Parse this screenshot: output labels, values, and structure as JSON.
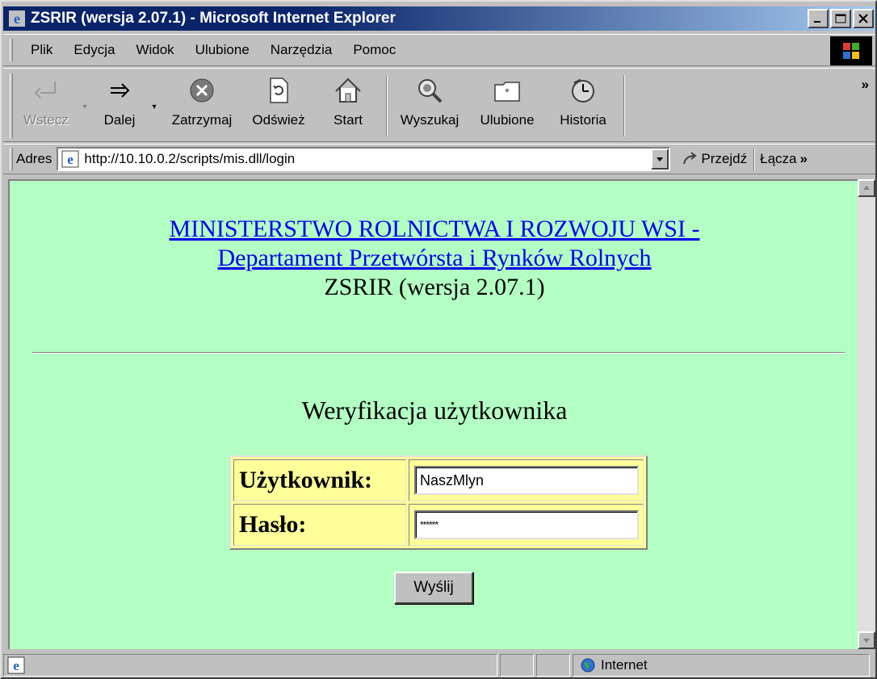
{
  "window": {
    "title": "ZSRIR (wersja 2.07.1) - Microsoft Internet Explorer"
  },
  "menu": {
    "items": [
      "Plik",
      "Edycja",
      "Widok",
      "Ulubione",
      "Narzędzia",
      "Pomoc"
    ]
  },
  "toolbar": {
    "back": "Wstecz",
    "forward": "Dalej",
    "stop": "Zatrzymaj",
    "refresh": "Odśwież",
    "home": "Start",
    "search": "Wyszukaj",
    "favorites": "Ulubione",
    "history": "Historia",
    "more": "»"
  },
  "address": {
    "label": "Adres",
    "url": "http://10.10.0.2/scripts/mis.dll/login",
    "go": "Przejdź",
    "links": "Łącza",
    "links_more": "»"
  },
  "page": {
    "ministry_line1": "MINISTERSTWO ROLNICTWA I ROZWOJU WSI -",
    "ministry_line2": "Departament Przetwórsta i Rynków Rolnych",
    "version": "ZSRIR (wersja 2.07.1)",
    "subheading": "Weryfikacja użytkownika",
    "user_label": "Użytkownik:",
    "user_value": "NaszMlyn",
    "password_label": "Hasło:",
    "password_value": "******",
    "submit": "Wyślij"
  },
  "status": {
    "zone": "Internet"
  },
  "colors": {
    "page_bg": "#b3ffc3",
    "table_bg": "#ffff99",
    "link": "#0000ee",
    "title_bar": "#0a246a"
  }
}
